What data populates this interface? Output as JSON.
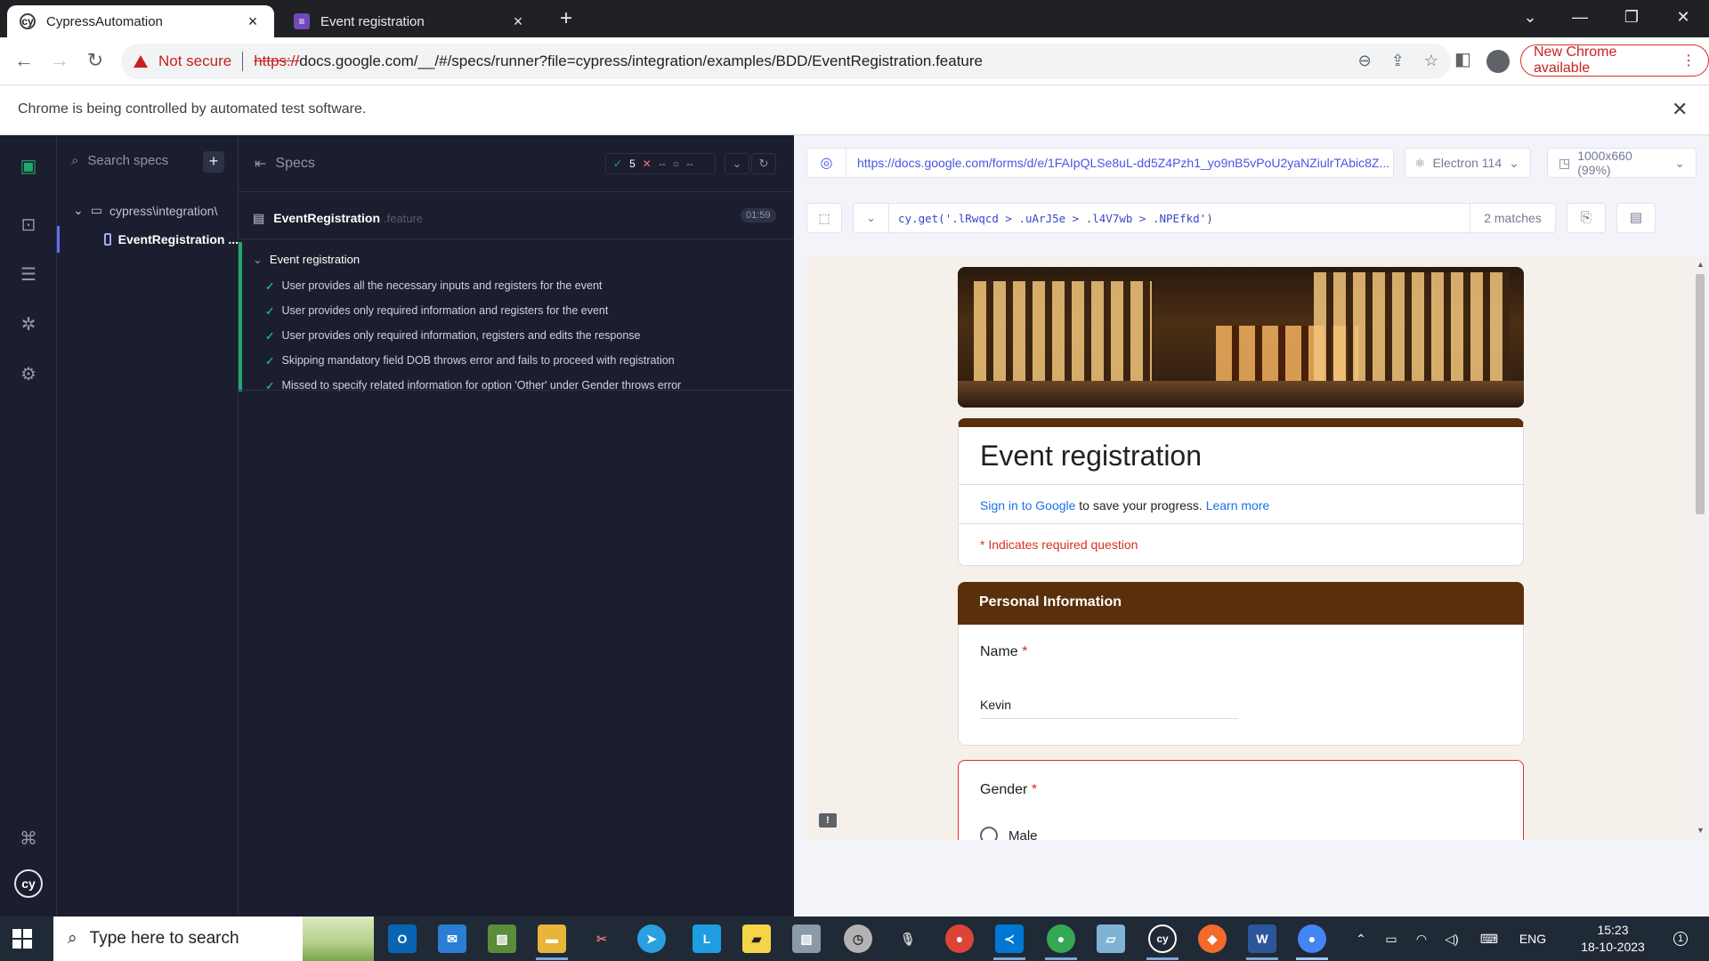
{
  "browser": {
    "tabs": [
      {
        "title": "CypressAutomation",
        "active": true
      },
      {
        "title": "Event registration",
        "active": false
      }
    ],
    "not_secure_label": "Not secure",
    "url_scheme": "https://",
    "url_rest": "docs.google.com/__/#/specs/runner?file=cypress/integration/examples/BDD/EventRegistration.feature",
    "new_chrome_label": "New Chrome available",
    "automation_notice": "Chrome is being controlled by automated test software."
  },
  "cypress": {
    "search_placeholder": "Search specs",
    "add_label": "+",
    "folder_name": "cypress\\integration\\",
    "selected_spec": "EventRegistration ...",
    "reporter": {
      "specs_label": "Specs",
      "passed": "5",
      "failed": "--",
      "pending": "--",
      "spec_name": "EventRegistration",
      "spec_ext": ".feature",
      "duration": "01:59",
      "suite_title": "Event registration",
      "tests": [
        "User provides all the necessary inputs and registers for the event",
        "User provides only required information and registers for the event",
        "User provides only required information, registers and edits the response",
        "Skipping mandatory field DOB throws error and fails to proceed with registration",
        "Missed to specify related information for option 'Other' under Gender throws error"
      ]
    },
    "aut": {
      "url": "https://docs.google.com/forms/d/e/1FAIpQLSe8uL-dd5Z4Pzh1_yo9nB5vPoU2yaNZiulrTAbic8Z...",
      "browser": "Electron 114",
      "viewport": "1000x660 (99%)",
      "selector_fn": "cy.get(",
      "selector_arg": "'.lRwqcd > .uArJ5e > .l4V7wb > .NPEfkd'",
      "selector_close": ")",
      "matches": "2 matches"
    }
  },
  "form": {
    "title": "Event registration",
    "signin_link": "Sign in to Google",
    "signin_rest": " to save your progress.",
    "learn_more": "Learn more",
    "required_note": "* Indicates required question",
    "section_title": "Personal Information",
    "name_label": "Name",
    "name_value": "Kevin",
    "gender_label": "Gender",
    "gender_option_1": "Male",
    "required_marker": "*"
  },
  "taskbar": {
    "search_placeholder": "Type here to search",
    "language": "ENG",
    "time": "15:23",
    "date": "18-10-2023",
    "notification_count": "1"
  }
}
